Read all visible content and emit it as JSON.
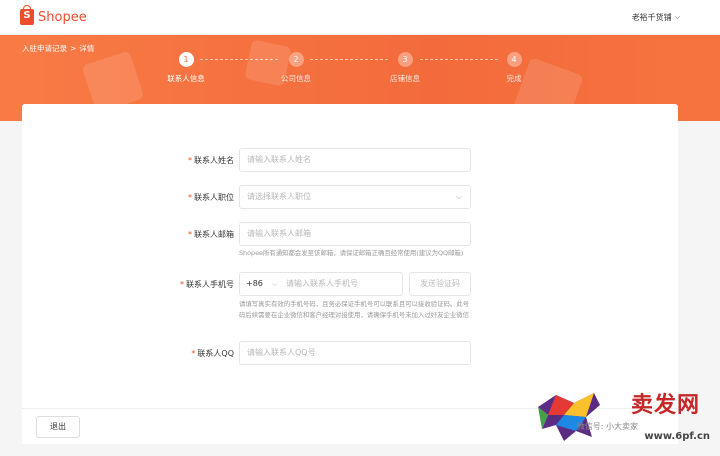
{
  "header": {
    "brand": "Shopee",
    "brand_letter": "S",
    "user_menu": "老裕千货铺"
  },
  "breadcrumb": {
    "parent": "入驻申请记录",
    "separator": ">",
    "current": "详情"
  },
  "steps": [
    {
      "number": "1",
      "label": "联系人信息"
    },
    {
      "number": "2",
      "label": "公司信息"
    },
    {
      "number": "3",
      "label": "店铺信息"
    },
    {
      "number": "4",
      "label": "完成"
    }
  ],
  "form": {
    "name": {
      "label": "联系人姓名",
      "placeholder": "请输入联系人姓名"
    },
    "position": {
      "label": "联系人职位",
      "placeholder": "请选择联系人职位"
    },
    "email": {
      "label": "联系人邮箱",
      "placeholder": "请输入联系人邮箱",
      "hint": "Shopee所有通知都会发至该邮箱，请保证邮箱正确且经常使用(建议为QQ邮箱)"
    },
    "phone": {
      "label": "联系人手机号",
      "country_code": "+86",
      "placeholder": "请输入联系人手机号",
      "verify_button": "发送验证码",
      "hint": "请填写真实有效的手机号码，且务必保证手机号可以联系且可以接收验证码。此号码后续需要在企业微信和客户经理对接使用，请确保手机号未加入过好友企业微信"
    },
    "qq": {
      "label": "联系人QQ",
      "placeholder": "请输入联系人QQ号"
    }
  },
  "footer": {
    "exit_button": "退出"
  },
  "watermark": {
    "title": "卖发网",
    "subtitle": "微信号: 小大卖家",
    "url": "www.6pf.cn"
  },
  "colors": {
    "brand": "#ee4d2d",
    "banner": "#f36b3c"
  }
}
